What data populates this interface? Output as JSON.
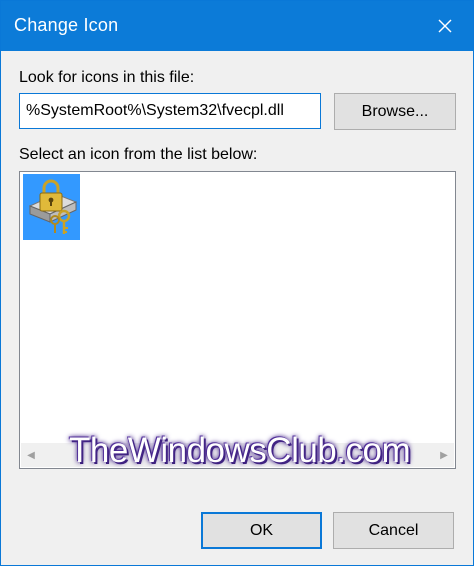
{
  "window": {
    "title": "Change Icon",
    "close_icon": "close-icon",
    "accent_color": "#0c7bd8"
  },
  "file_section": {
    "label": "Look for icons in this file:",
    "path_value": "%SystemRoot%\\System32\\fvecpl.dll",
    "browse_label": "Browse..."
  },
  "icon_section": {
    "label": "Select an icon from the list below:",
    "icons": [
      {
        "name": "bitlocker-drive-keys-icon",
        "selected": true,
        "selection_color": "#3399ff"
      }
    ],
    "scroll_left_icon": "scroll-left-arrow",
    "scroll_right_icon": "scroll-right-arrow"
  },
  "footer": {
    "ok_label": "OK",
    "cancel_label": "Cancel"
  },
  "watermark": {
    "text": "TheWindowsClub.com"
  }
}
